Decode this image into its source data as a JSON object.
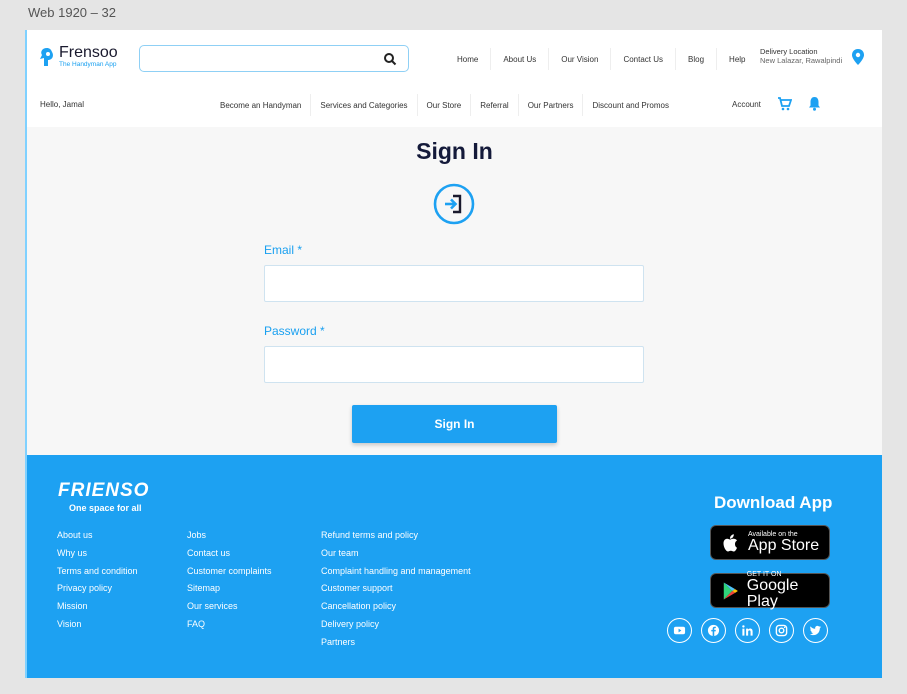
{
  "frame_label": "Web 1920 – 32",
  "header": {
    "logo_name": "Frensoo",
    "logo_tagline": "The Handyman App",
    "search_placeholder": "",
    "top_nav": [
      "Home",
      "About Us",
      "Our Vision",
      "Contact Us",
      "Blog",
      "Help"
    ],
    "delivery_label": "Delivery Location",
    "delivery_value": "New Lalazar, Rawalpindi",
    "greeting": "Hello, Jamal",
    "sub_nav": [
      "Become an Handyman",
      "Services and Categories",
      "Our Store",
      "Referral",
      "Our Partners",
      "Discount and Promos"
    ],
    "account_label": "Account"
  },
  "signin": {
    "title": "Sign In",
    "email_label": "Email",
    "password_label": "Password",
    "required_mark": "*",
    "email_value": "",
    "password_value": "",
    "button_label": "Sign In"
  },
  "footer": {
    "brand": "FRIENSO",
    "tagline": "One space for all",
    "col1": [
      "About us",
      "Why us",
      "Terms and condition",
      "Privacy policy",
      "Mission",
      "Vision"
    ],
    "col2": [
      "Jobs",
      "Contact us",
      "Customer complaints",
      "Sitemap",
      "Our services",
      "FAQ"
    ],
    "col3": [
      "Refund terms and  policy",
      "Our team",
      "Complaint handling and management",
      "Customer support",
      "Cancellation policy",
      "Delivery policy",
      "Partners"
    ],
    "download_title": "Download App",
    "appstore_small": "Available on the",
    "appstore_big": "App Store",
    "playstore_small": "GET IT ON",
    "playstore_big": "Google Play",
    "socials": [
      "youtube-icon",
      "facebook-icon",
      "linkedin-icon",
      "instagram-icon",
      "twitter-icon"
    ]
  },
  "colors": {
    "accent": "#1da1f2",
    "title": "#141a3a"
  }
}
